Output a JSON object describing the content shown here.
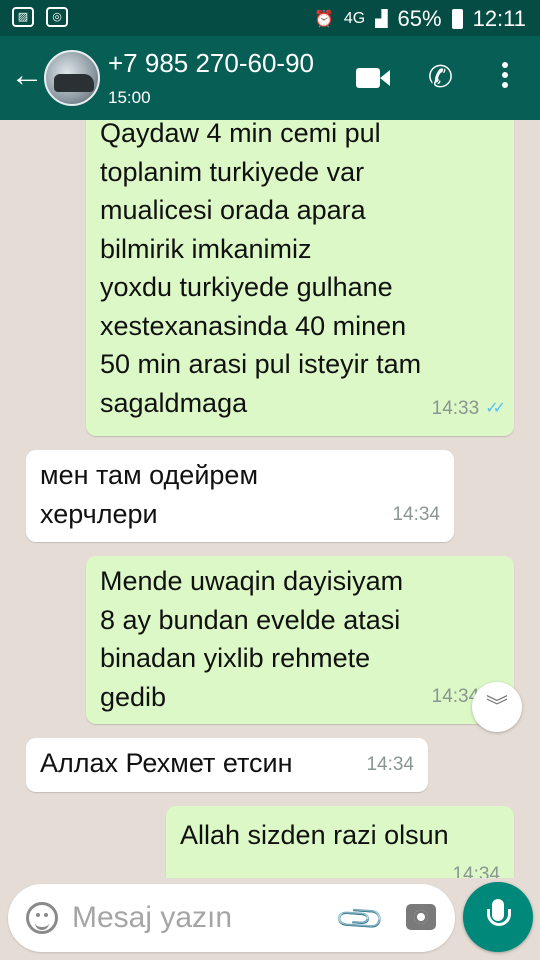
{
  "status_bar": {
    "network": "4G",
    "battery": "65%",
    "time": "12:11"
  },
  "header": {
    "contact": "+7 985 270-60-90",
    "status": "15:00"
  },
  "messages": [
    {
      "direction": "out",
      "text": "Qaydaw 4 min cemi pul\ntoplanim turkiyede var\nmualicesi orada apara\nbilmirik imkanimiz\nyoxdu turkiyede gulhane\nxestexanasinda 40   minen\n50 min arasi pul isteyir tam\nsagaldmaga",
      "time": "14:33",
      "read": true
    },
    {
      "direction": "in",
      "text": "мен там одейрем\nхерчлери",
      "time": "14:34"
    },
    {
      "direction": "out",
      "text": "Mende uwaqin dayisiyam\n8 ay bundan evelde atasi\nbinadan yixlib rehmete\ngedib",
      "time": "14:34",
      "read": true
    },
    {
      "direction": "in",
      "text": "Аллах Рехмет етсин",
      "time": "14:34"
    },
    {
      "direction": "out",
      "text": "Allah sizden razi olsun",
      "time": "14:34"
    }
  ],
  "input": {
    "placeholder": "Mesaj yazın"
  },
  "icons": {
    "back": "arrow-left-icon",
    "video": "video-camera-icon",
    "call": "phone-icon",
    "menu": "more-vert-icon",
    "emoji": "emoji-icon",
    "attach": "paperclip-icon",
    "camera": "camera-icon",
    "mic": "mic-icon",
    "scroll": "chevron-double-down-icon"
  },
  "colors": {
    "header": "#075e54",
    "status_bar": "#054d44",
    "outgoing_bubble": "#dcf8c6",
    "incoming_bubble": "#ffffff",
    "chat_bg": "#e5ddd5",
    "read_ticks": "#4fc3f7",
    "mic_button": "#00897b"
  }
}
